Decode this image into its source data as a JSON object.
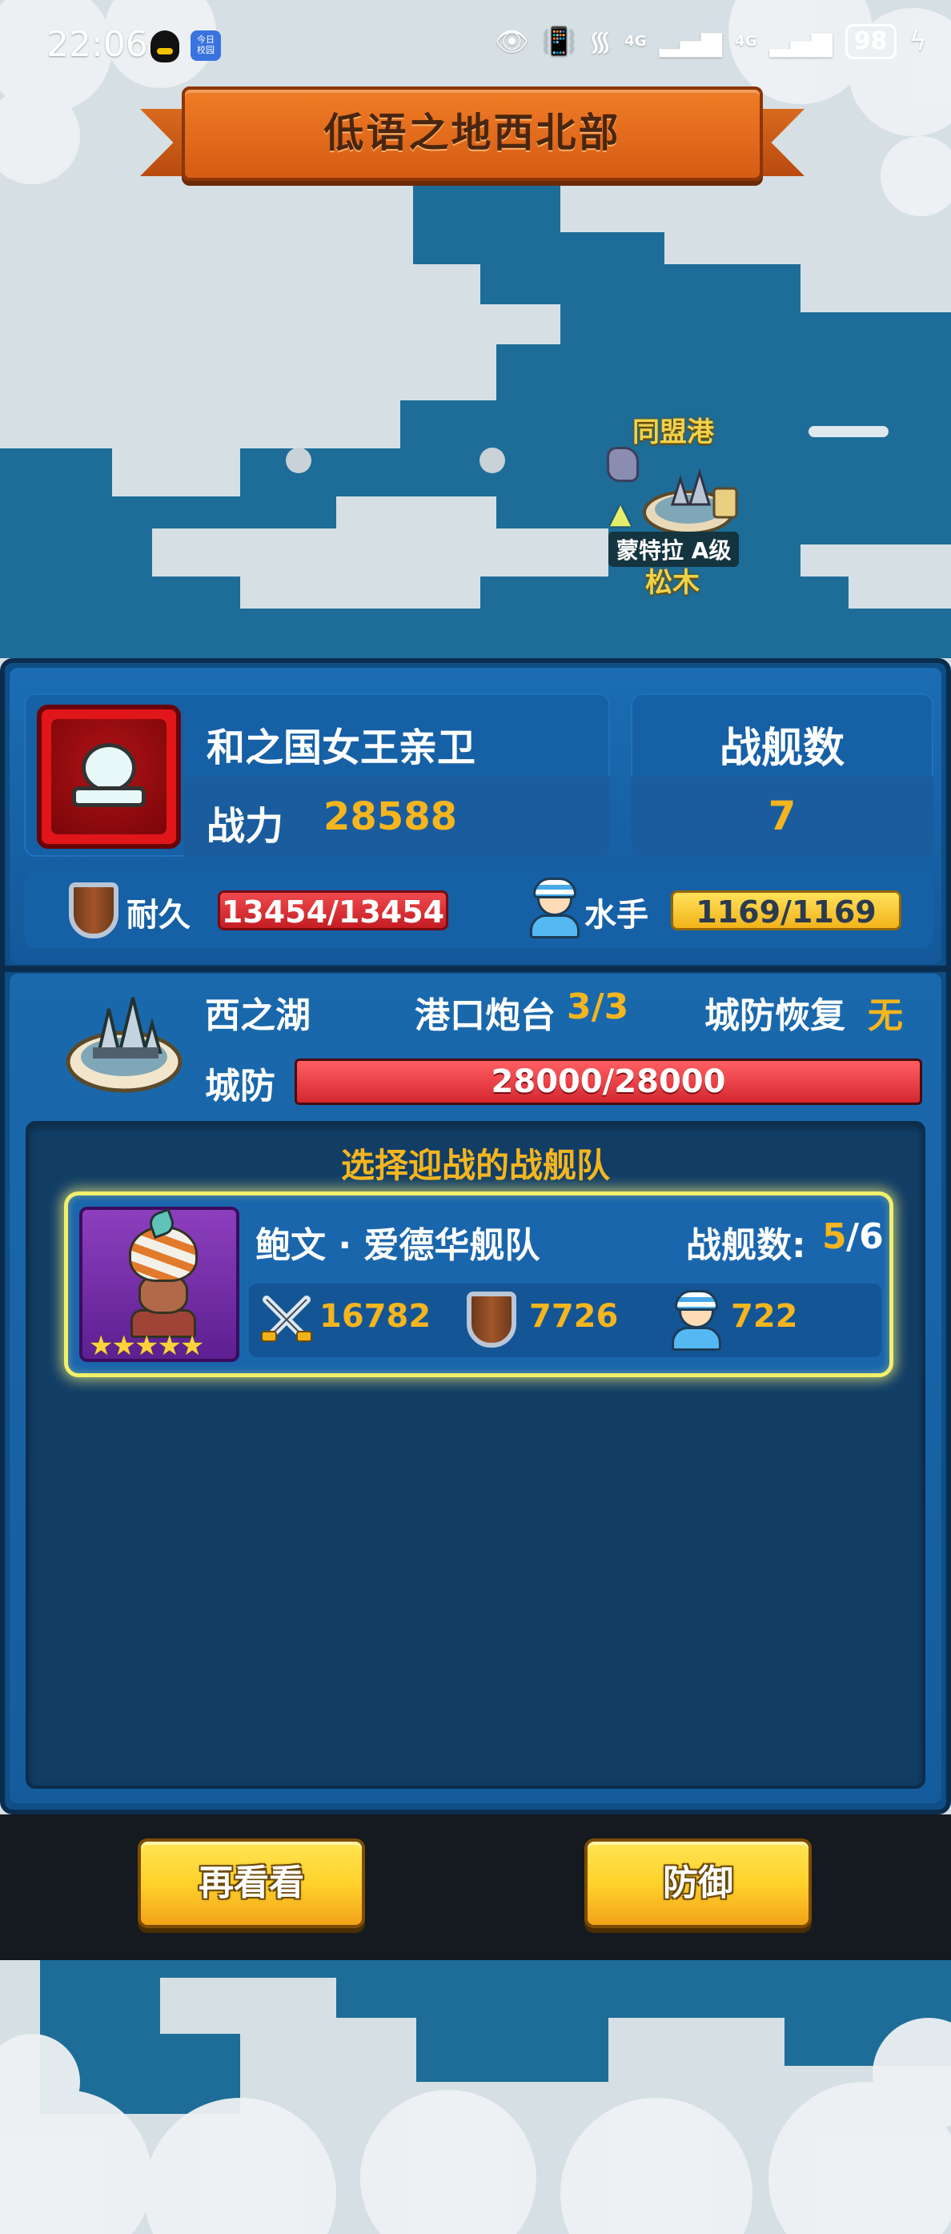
{
  "status_bar": {
    "time": "22:06",
    "news_icon_text": "今日\n校园",
    "battery": "98",
    "net1": "4G",
    "net2": "4G"
  },
  "map": {
    "region_title": "低语之地西北部",
    "port_label": "同盟港",
    "captain_label": "蒙特拉 A级",
    "node_label": "松木"
  },
  "player": {
    "name": "和之国女王亲卫",
    "power_label": "战力",
    "power_value": "28588",
    "ships_label": "战舰数",
    "ships_value": "7",
    "durability_label": "耐久",
    "durability_value": "13454/13454",
    "sailor_label": "水手",
    "sailor_value": "1169/1169"
  },
  "city": {
    "name": "西之湖",
    "battery_label": "港口炮台",
    "battery_value": "3/3",
    "recover_label": "城防恢复",
    "recover_value": "无",
    "defense_label": "城防",
    "defense_value": "28000/28000",
    "defense_fraction": 1.0
  },
  "fleet_select": {
    "title": "选择迎战的战舰队",
    "fleets": [
      {
        "name": "鲍文 · 爱德华舰队",
        "count_label": "战舰数:",
        "count_current": "5",
        "count_max": "/6",
        "stars": "★★★★★",
        "attack": "16782",
        "defense": "7726",
        "sailors": "722"
      }
    ]
  },
  "buttons": {
    "back_label": "再看看",
    "defend_label": "防御"
  },
  "colors": {
    "accent_gold": "#f4b51e",
    "panel_blue": "#1660a6",
    "selected_glow": "#f2ef6a"
  }
}
